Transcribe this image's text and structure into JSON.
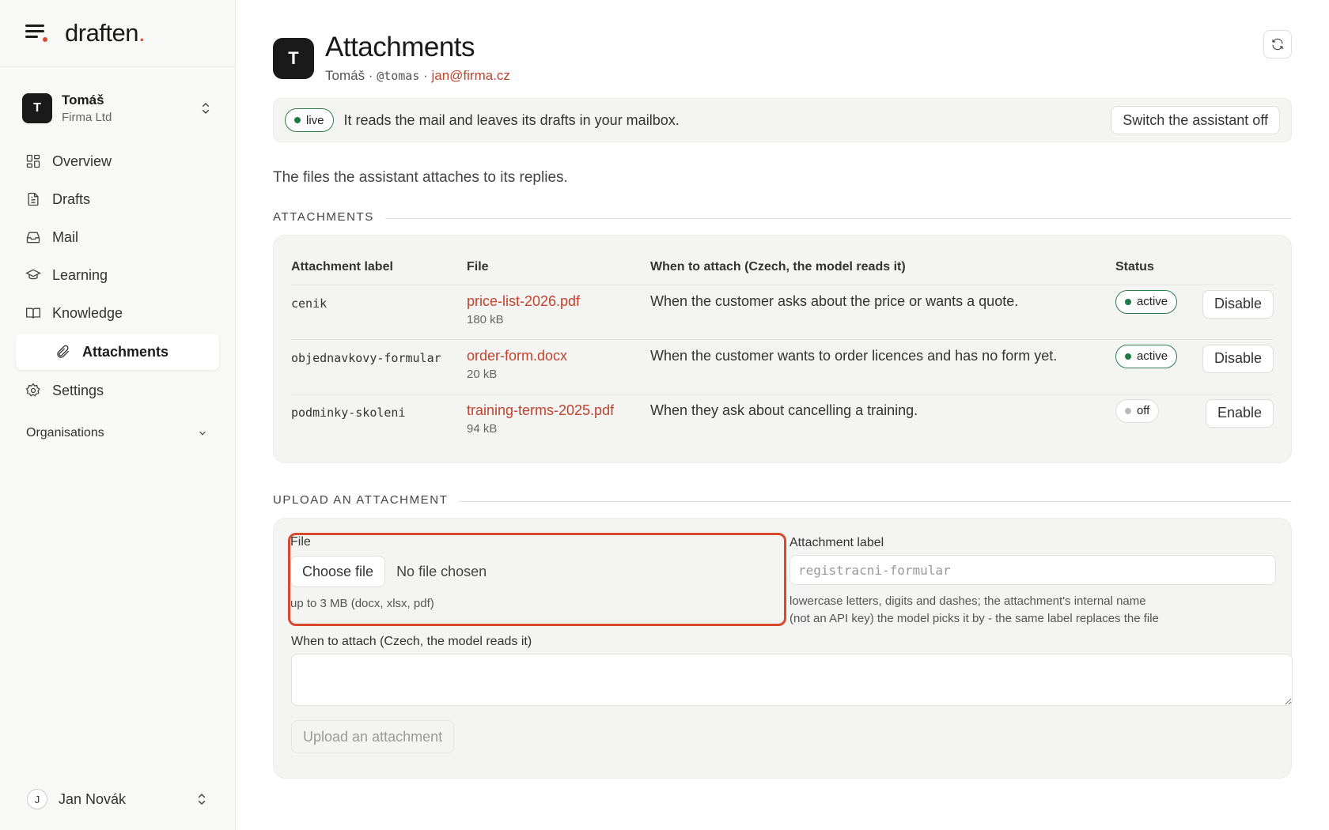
{
  "brand": {
    "name": "draften",
    "accent": "."
  },
  "account": {
    "initial": "T",
    "name": "Tomáš",
    "org": "Firma Ltd"
  },
  "nav": {
    "overview": "Overview",
    "drafts": "Drafts",
    "mail": "Mail",
    "learning": "Learning",
    "knowledge": "Knowledge",
    "attachments": "Attachments",
    "settings": "Settings",
    "organisations": "Organisations"
  },
  "user": {
    "initial": "J",
    "name": "Jan Novák"
  },
  "page": {
    "avatar": "T",
    "title": "Attachments",
    "sub_name": "Tomáš",
    "sub_handle": "@tomas",
    "sub_email": "jan@firma.cz",
    "sep": " · "
  },
  "live": {
    "badge": "live",
    "text": "It reads the mail and leaves its drafts in your mailbox.",
    "switch_label": "Switch the assistant off"
  },
  "intro": "The files the assistant attaches to its replies.",
  "attachments_section": {
    "heading": "ATTACHMENTS",
    "columns": [
      "Attachment label",
      "File",
      "When to attach (Czech, the model reads it)",
      "Status"
    ],
    "rows": [
      {
        "label": "cenik",
        "file": "price-list-2026.pdf",
        "size": "180 kB",
        "when": "When the customer asks about the price or wants a quote.",
        "status": "active",
        "action": "Disable"
      },
      {
        "label": "objednavkovy-formular",
        "file": "order-form.docx",
        "size": "20 kB",
        "when": "When the customer wants to order licences and has no form yet.",
        "status": "active",
        "action": "Disable"
      },
      {
        "label": "podminky-skoleni",
        "file": "training-terms-2025.pdf",
        "size": "94 kB",
        "when": "When they ask about cancelling a training.",
        "status": "off",
        "action": "Enable"
      }
    ]
  },
  "upload": {
    "heading": "UPLOAD AN ATTACHMENT",
    "file_label": "File",
    "choose_label": "Choose file",
    "no_file": "No file chosen",
    "file_hint": "up to 3 MB (docx, xlsx, pdf)",
    "att_label": "Attachment label",
    "att_placeholder": "registracni-formular",
    "att_hint_1": "lowercase letters, digits and dashes; the attachment's internal name",
    "att_hint_2": "(not an API key) the model picks it by - the same label replaces the file",
    "when_label": "When to attach (Czech, the model reads it)",
    "submit_label": "Upload an attachment"
  },
  "colors": {
    "accent": "#d24c34",
    "link": "#c0432d",
    "active": "#1f7a45",
    "highlight": "#d8492f"
  }
}
